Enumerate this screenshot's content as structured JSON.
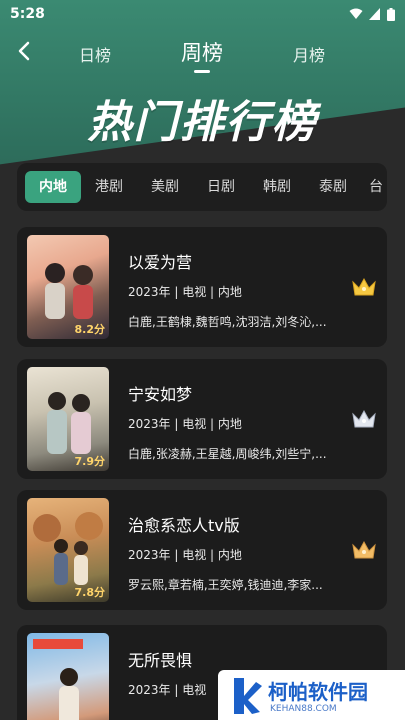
{
  "status": {
    "time": "5:28"
  },
  "nav": {
    "tabs": [
      {
        "label": "日榜"
      },
      {
        "label": "周榜"
      },
      {
        "label": "月榜"
      }
    ]
  },
  "title": "热门排行榜",
  "categories": [
    "内地",
    "港剧",
    "美剧",
    "日剧",
    "韩剧",
    "泰剧",
    "台"
  ],
  "cards": [
    {
      "title": "以爱为营",
      "meta": "2023年 | 电视 | 内地",
      "cast": "白鹿,王鹤棣,魏哲鸣,沈羽洁,刘冬沁,...",
      "score": "8.2分",
      "crown": "gold"
    },
    {
      "title": "宁安如梦",
      "meta": "2023年 | 电视 | 内地",
      "cast": "白鹿,张凌赫,王星越,周峻纬,刘些宁,...",
      "score": "7.9分",
      "crown": "silver"
    },
    {
      "title": "治愈系恋人tv版",
      "meta": "2023年 | 电视 | 内地",
      "cast": "罗云熙,章若楠,王奕婷,钱迪迪,李家...",
      "score": "7.8分",
      "crown": "bronze"
    },
    {
      "title": "无所畏惧",
      "meta": "2023年 | 电视",
      "cast": "",
      "score": "",
      "crown": ""
    }
  ],
  "colors": {
    "accent": "#3aa37f",
    "gold": "#f5c842",
    "silver": "#d9dde6",
    "bronze": "#f0b860"
  },
  "watermark": {
    "brand": "柯帕软件园",
    "url": "KEHAN88.COM"
  }
}
